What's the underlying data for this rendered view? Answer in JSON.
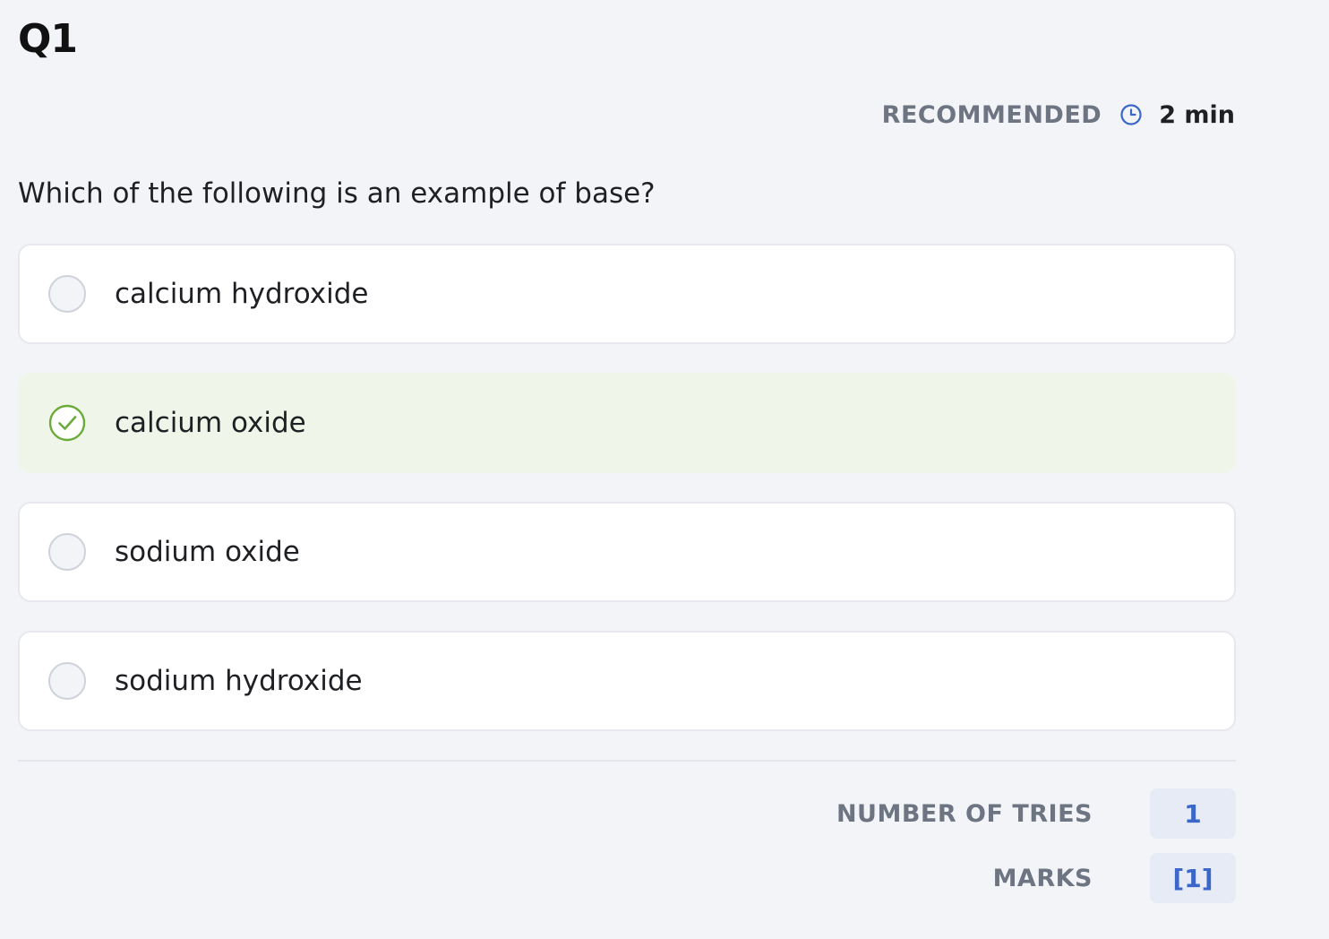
{
  "question": {
    "number": "Q1",
    "recommended_label": "RECOMMENDED",
    "recommended_time": "2 min",
    "text": "Which of the following is an example of base?"
  },
  "options": [
    {
      "label": "calcium hydroxide",
      "state": "unselected"
    },
    {
      "label": "calcium oxide",
      "state": "correct"
    },
    {
      "label": "sodium oxide",
      "state": "unselected"
    },
    {
      "label": "sodium hydroxide",
      "state": "unselected"
    }
  ],
  "stats": {
    "tries_label": "NUMBER OF TRIES",
    "tries_value": "1",
    "marks_label": "MARKS",
    "marks_value": "[1]"
  },
  "icons": {
    "clock": "clock-icon",
    "check": "check-circle-icon"
  },
  "colors": {
    "accent_blue": "#3a67c8",
    "correct_green": "#6aab3a",
    "correct_background": "#eff5e9",
    "muted_label": "#6d7482"
  }
}
